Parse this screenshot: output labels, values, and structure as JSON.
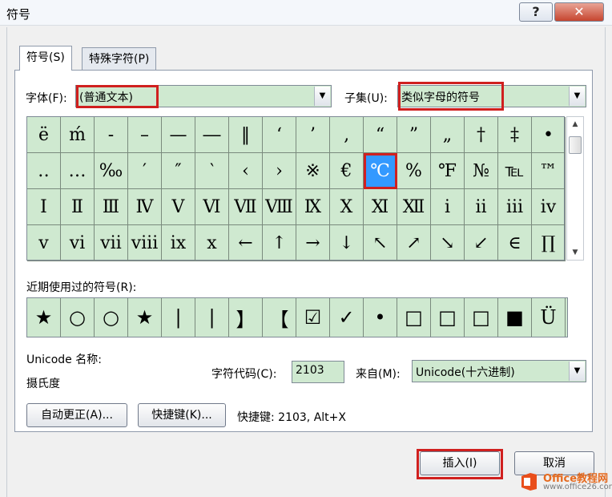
{
  "window": {
    "title": "符号",
    "help_label": "?",
    "close_label": "✕"
  },
  "tabs": [
    {
      "label": "符号(S)"
    },
    {
      "label": "特殊字符(P)"
    }
  ],
  "font": {
    "label": "字体(F):",
    "value": "(普通文本)"
  },
  "subset": {
    "label": "子集(U):",
    "value": "类似字母的符号"
  },
  "symbols": [
    [
      "ë",
      "ḿ",
      "‐",
      "–",
      "—",
      "―",
      "‖",
      "‘",
      "’",
      "‚",
      "“",
      "”",
      "„",
      "†",
      "‡",
      "•"
    ],
    [
      "‥",
      "…",
      "‰",
      "′",
      "″",
      "‵",
      "‹",
      "›",
      "※",
      "€",
      "℃",
      "%",
      "℉",
      "№",
      "℡",
      "™"
    ],
    [
      "Ⅰ",
      "Ⅱ",
      "Ⅲ",
      "Ⅳ",
      "Ⅴ",
      "Ⅵ",
      "Ⅶ",
      "Ⅷ",
      "Ⅸ",
      "Ⅹ",
      "Ⅺ",
      "Ⅻ",
      "ⅰ",
      "ⅱ",
      "ⅲ",
      "ⅳ"
    ],
    [
      "ⅴ",
      "ⅵ",
      "ⅶ",
      "ⅷ",
      "ⅸ",
      "ⅹ",
      "←",
      "↑",
      "→",
      "↓",
      "↖",
      "↗",
      "↘",
      "↙",
      "∈",
      "∏"
    ]
  ],
  "selected_symbol": "℃",
  "recent": {
    "label": "近期使用过的符号(R):",
    "symbols": [
      "★",
      "○",
      "○",
      "★",
      "|",
      "|",
      "】",
      "【",
      "☑",
      "✓",
      "•",
      "□",
      "□",
      "□",
      "■",
      "Ü"
    ]
  },
  "unicode_name": {
    "label": "Unicode 名称:",
    "value": "摄氏度"
  },
  "char_code": {
    "label": "字符代码(C):",
    "value": "2103"
  },
  "from": {
    "label": "来自(M):",
    "value": "Unicode(十六进制)"
  },
  "buttons": {
    "autocorrect": "自动更正(A)...",
    "shortcut_key": "快捷键(K)...",
    "insert": "插入(I)",
    "cancel": "取消"
  },
  "shortcut_text": "快捷键: 2103, Alt+X",
  "watermark": {
    "brand": "Office教程网",
    "url": "www.office26.com"
  },
  "colors": {
    "grid_bg": "#cfe9d0",
    "selected_bg": "#3399ff",
    "highlight_red": "#d0201f"
  },
  "icons": {
    "dropdown": "chevron-down-icon",
    "scroll_up": "scroll-up-icon",
    "scroll_down": "scroll-down-icon"
  }
}
